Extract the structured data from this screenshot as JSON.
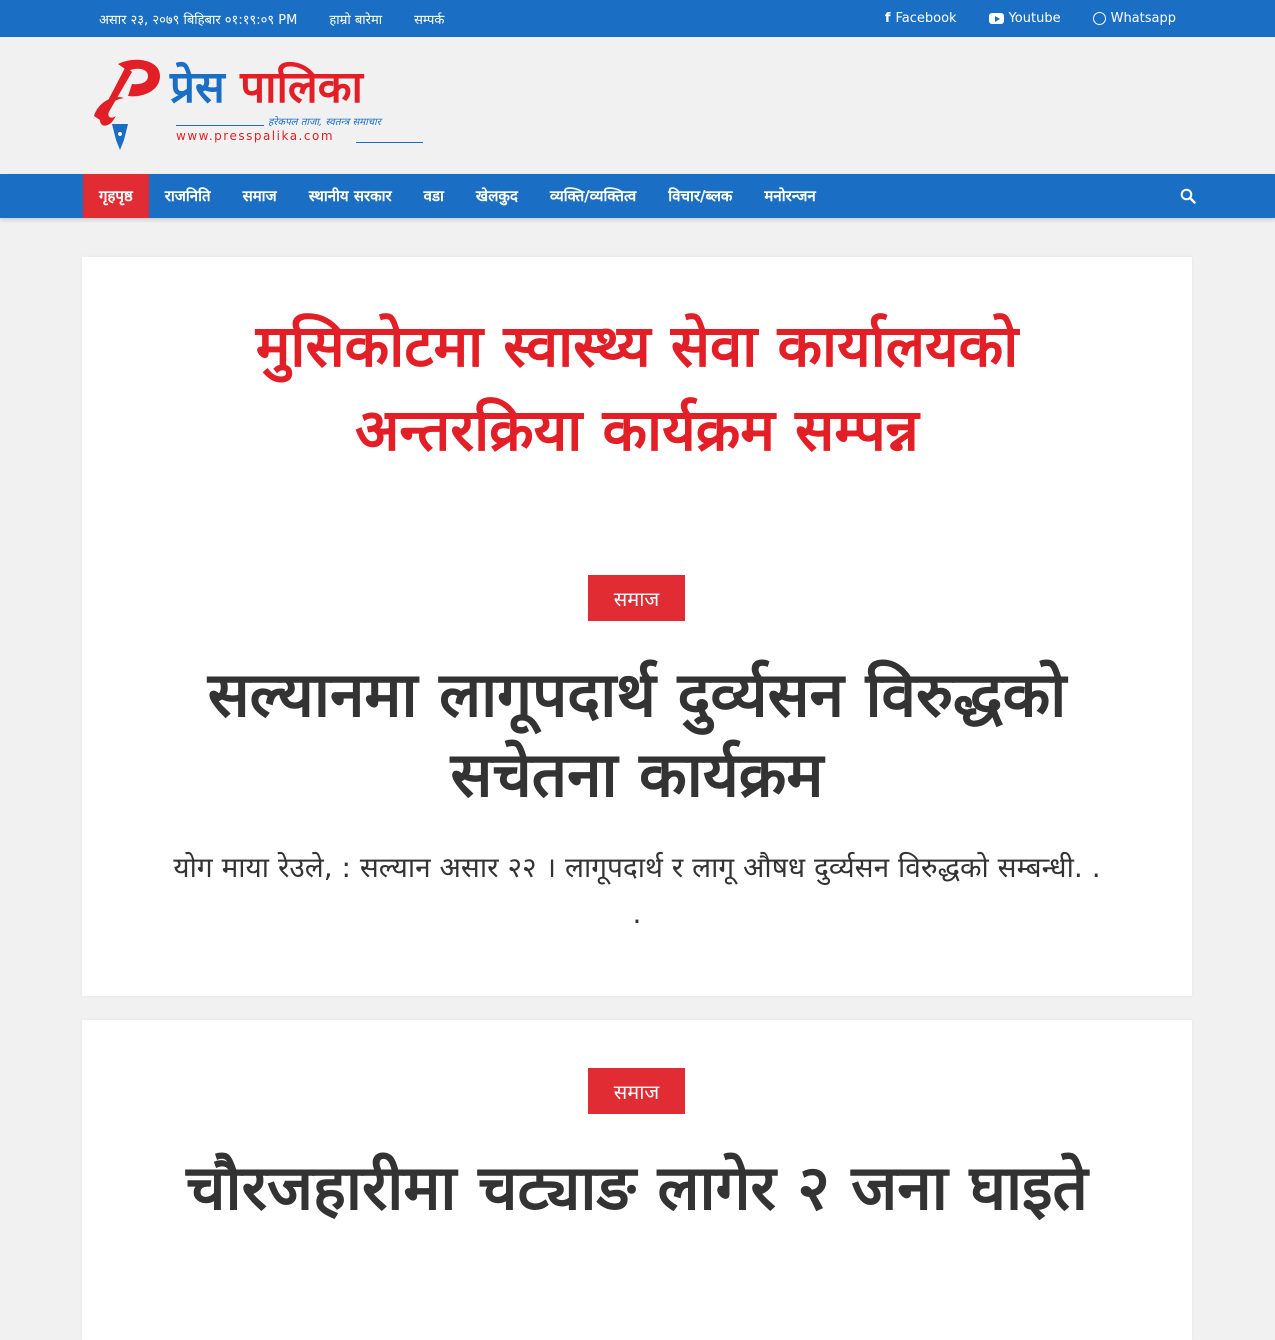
{
  "topbar": {
    "date": "असार २३, २०७९ बिहिबार ०१:१९:०९ PM",
    "links": [
      "हाम्रो बारेमा",
      "सम्पर्क"
    ],
    "social": [
      {
        "label": "Facebook",
        "icon": "facebook-icon"
      },
      {
        "label": "Youtube",
        "icon": "youtube-icon"
      },
      {
        "label": "Whatsapp",
        "icon": "whatsapp-icon"
      }
    ]
  },
  "logo": {
    "brand_part1": "प्रेस",
    "brand_part2": "पालिका",
    "tagline": "हरेकपल ताजा, स्वतन्त्र समाचार",
    "url": "www.presspalika.com"
  },
  "nav": {
    "items": [
      "गृहपृष्ठ",
      "राजनिति",
      "समाज",
      "स्थानीय सरकार",
      "वडा",
      "खेलकुद",
      "व्यक्ति/व्यक्तित्व",
      "विचार/ब्लक",
      "मनोरन्जन"
    ],
    "active_index": 0,
    "search_icon": "search-icon"
  },
  "featured": {
    "headline": "मुसिकोटमा स्वास्थ्य सेवा कार्यालयको अन्तरक्रिया कार्यक्रम सम्पन्न",
    "category": "समाज",
    "title": "सल्यानमा लागूपदार्थ दुर्व्यसन विरुद्धको सचेतना कार्यक्रम",
    "excerpt": "योग माया रेउले, : सल्यान असार  २२ । लागूपदार्थ र लागू औषध दुर्व्यसन विरुद्धको सम्बन्धी. . ."
  },
  "second": {
    "category": "समाज",
    "title": "चौरजहारीमा चट्याङ लागेर २ जना घाइते"
  },
  "colors": {
    "primary_blue": "#1a6fc4",
    "accent_red": "#e21f26",
    "background": "#f1f1f1"
  }
}
